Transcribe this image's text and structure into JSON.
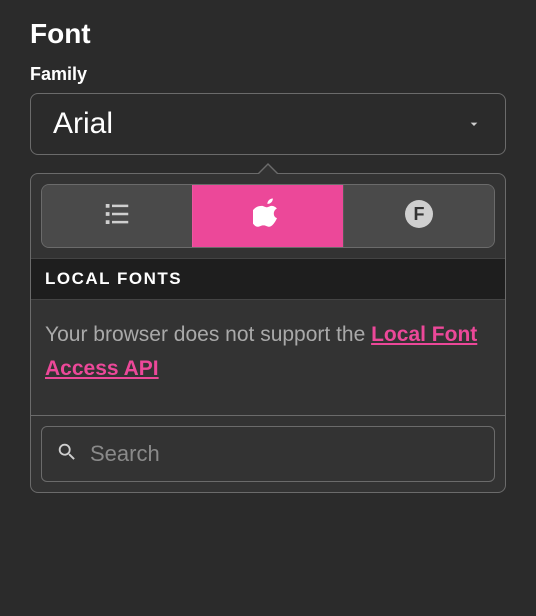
{
  "section": {
    "title": "Font"
  },
  "family": {
    "label": "Family",
    "value": "Arial"
  },
  "popover": {
    "tabs": {
      "list_icon": "list-icon",
      "apple_icon": "apple-icon",
      "f_icon": "font-badge-icon",
      "active_index": 1
    },
    "section_header": "LOCAL FONTS",
    "message_prefix": "Your browser does not support the ",
    "message_link": "Local Font Access API",
    "search": {
      "placeholder": "Search",
      "value": ""
    }
  },
  "colors": {
    "accent": "#ec4899"
  }
}
